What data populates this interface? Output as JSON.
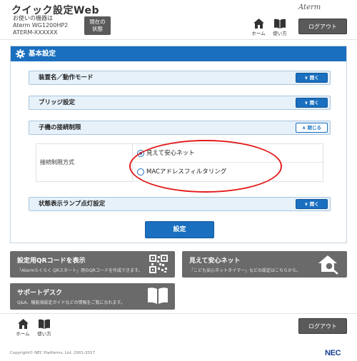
{
  "header": {
    "app_title": "クイック設定Web",
    "device_caption": "お使いの機器は",
    "device_model": "Aterm WG1200HP2",
    "device_ssid": "ATERM-XXXXXX",
    "status_button": "現在の\n状態",
    "brand": "Aterm",
    "home_label": "ホーム",
    "help_label": "使い方",
    "logout_label": "ログアウト"
  },
  "panel": {
    "title": "基本設定",
    "sections": [
      {
        "label": "装置名／動作モード",
        "button": "開く",
        "state": "collapsed"
      },
      {
        "label": "ブリッジ設定",
        "button": "開く",
        "state": "collapsed"
      },
      {
        "label": "子機の接続制限",
        "button": "閉じる",
        "state": "expanded"
      },
      {
        "label": "状態表示ランプ点灯設定",
        "button": "開く",
        "state": "collapsed"
      }
    ],
    "field": {
      "label": "接続制限方式",
      "options": [
        {
          "label": "見えて安心ネット",
          "selected": true
        },
        {
          "label": "MACアドレスフィルタリング",
          "selected": false
        }
      ]
    },
    "submit_label": "設定"
  },
  "tiles": [
    {
      "title": "設定用QRコードを表示",
      "desc": "「Atermらくらく QRスタート」用のQRコードを作成できます。",
      "icon": "qr-code-icon"
    },
    {
      "title": "見えて安心ネット",
      "desc": "「こども安心ネットタイマー」などの設定はこちらから。",
      "icon": "home-search-icon"
    },
    {
      "title": "サポートデスク",
      "desc": "Q&A、機能項設定ガイドなどの情報をご覧になれます。",
      "icon": "book-icon"
    }
  ],
  "footer": {
    "home_label": "ホーム",
    "help_label": "使い方",
    "logout_label": "ログアウト",
    "copyright": "Copyright© NEC Platforms, Ltd. 2001-2017",
    "logo": "NEC"
  },
  "colors": {
    "accent": "#1a6fbf",
    "tile": "#6a6a6a",
    "highlight": "#e31b1b"
  }
}
